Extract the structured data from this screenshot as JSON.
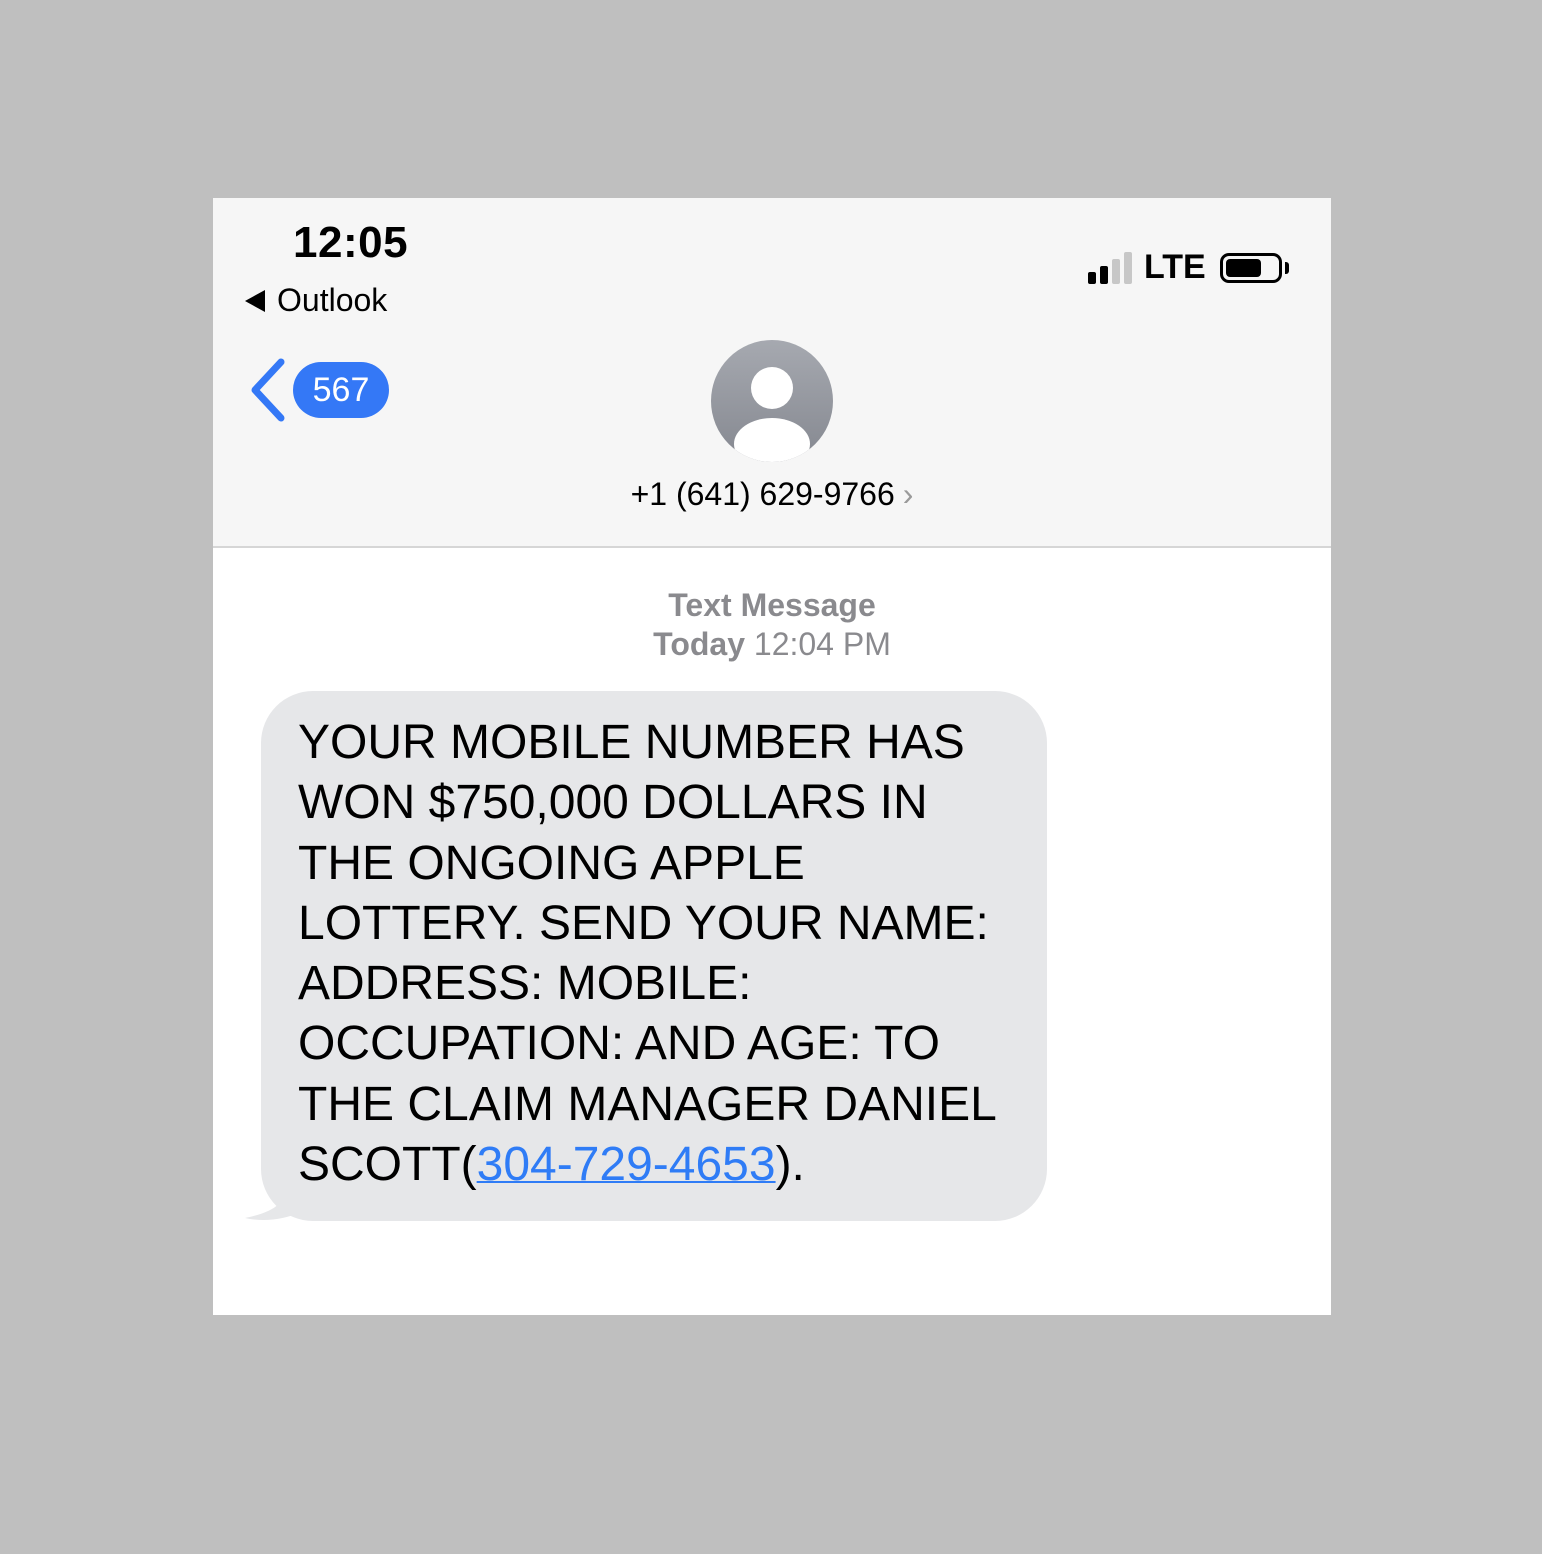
{
  "status_bar": {
    "time": "12:05",
    "back_app": "Outlook",
    "network": "LTE",
    "signal_bars_active": 2,
    "signal_bars_total": 4,
    "battery_level": 0.7
  },
  "nav": {
    "unread_count": "567",
    "contact_number": "+1 (641) 629-9766",
    "contact_chevron": "›",
    "avatar_icon": "person-silhouette-icon"
  },
  "thread": {
    "service_label": "Text Message",
    "day_label": "Today",
    "time_label": "12:04 PM"
  },
  "message": {
    "text_before": "YOUR MOBILE NUMBER HAS WON $750,000 DOLLARS IN THE ONGOING APPLE LOTTERY. SEND YOUR NAME: ADDRESS: MOBILE: OCCUPATION: AND AGE: TO THE CLAIM MANAGER DANIEL SCOTT(",
    "link_text": "304-729-4653",
    "text_after": ")."
  },
  "colors": {
    "background": "#bfbfbf",
    "header": "#f6f6f6",
    "accent_blue": "#3478f6",
    "bubble_gray": "#e6e7e9",
    "meta_gray": "#8a8a8e"
  }
}
